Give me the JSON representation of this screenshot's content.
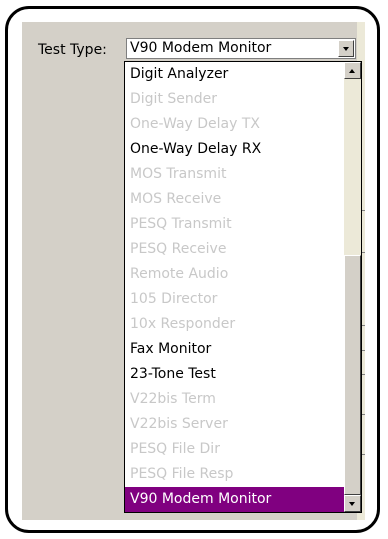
{
  "test_type": {
    "label": "Test Type:",
    "selected_value": "V90 Modem Monitor"
  },
  "dropdown": {
    "items": [
      {
        "label": "Digit Analyzer",
        "enabled": true,
        "selected": false
      },
      {
        "label": "Digit Sender",
        "enabled": false,
        "selected": false
      },
      {
        "label": "One-Way Delay TX",
        "enabled": false,
        "selected": false
      },
      {
        "label": "One-Way Delay RX",
        "enabled": true,
        "selected": false
      },
      {
        "label": "MOS Transmit",
        "enabled": false,
        "selected": false
      },
      {
        "label": "MOS Receive",
        "enabled": false,
        "selected": false
      },
      {
        "label": "PESQ Transmit",
        "enabled": false,
        "selected": false
      },
      {
        "label": "PESQ Receive",
        "enabled": false,
        "selected": false
      },
      {
        "label": "Remote Audio",
        "enabled": false,
        "selected": false
      },
      {
        "label": "105 Director",
        "enabled": false,
        "selected": false
      },
      {
        "label": "10x Responder",
        "enabled": false,
        "selected": false
      },
      {
        "label": "Fax Monitor",
        "enabled": true,
        "selected": false
      },
      {
        "label": "23-Tone Test",
        "enabled": true,
        "selected": false
      },
      {
        "label": "V22bis Term",
        "enabled": false,
        "selected": false
      },
      {
        "label": "V22bis Server",
        "enabled": false,
        "selected": false
      },
      {
        "label": "PESQ File Dir",
        "enabled": false,
        "selected": false
      },
      {
        "label": "PESQ File Resp",
        "enabled": false,
        "selected": false
      },
      {
        "label": "V90 Modem Monitor",
        "enabled": true,
        "selected": true
      }
    ]
  },
  "colors": {
    "selection": "#800080",
    "disabled_text": "#c8c8c8",
    "panel": "#d4d0c8"
  },
  "icons": {
    "combo_button": "chevron-down-icon",
    "scroll_up": "arrow-up-icon",
    "scroll_down": "arrow-down-icon"
  }
}
